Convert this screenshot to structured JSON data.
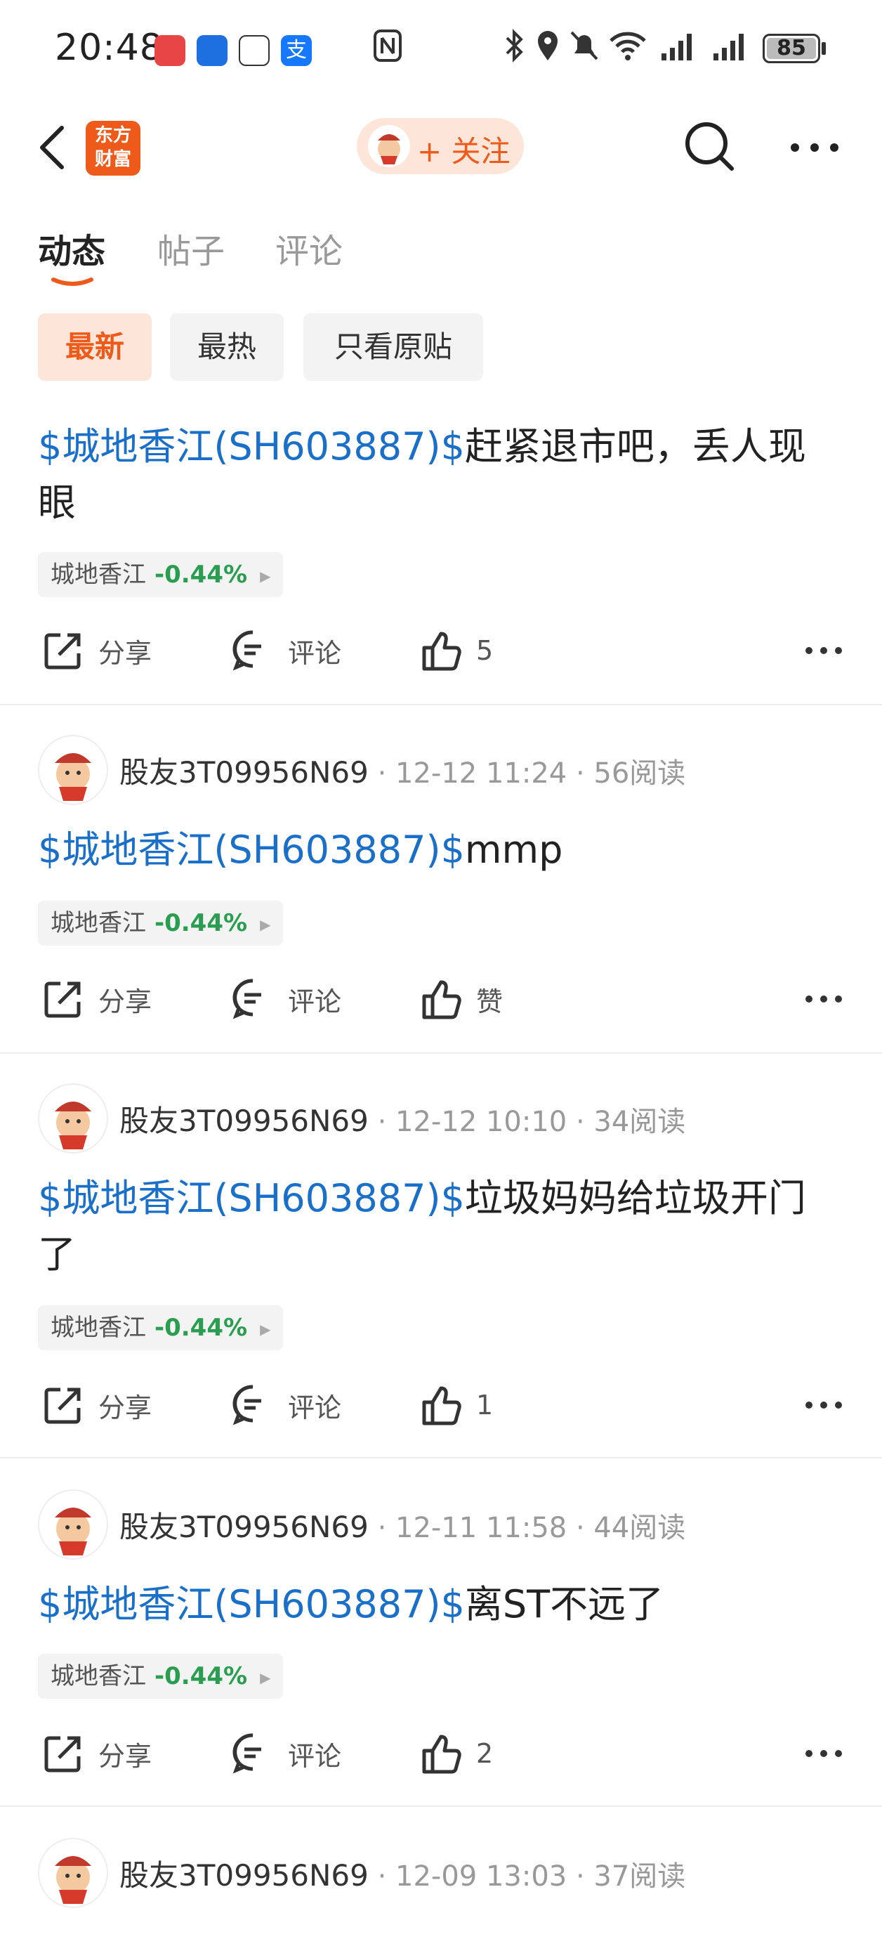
{
  "status_bar": {
    "time": "20:48",
    "battery": "85",
    "app_icons": [
      "huawei-icon",
      "browser-icon",
      "qq-icon",
      "alipay-icon"
    ],
    "icons": [
      "nfc-icon",
      "bluetooth-icon",
      "location-icon",
      "mute-icon",
      "wifi-icon",
      "signal-icon",
      "signal-icon",
      "battery-icon"
    ]
  },
  "header": {
    "logo_line1": "东方",
    "logo_line2": "财富",
    "follow_label": "+ 关注"
  },
  "tabs": [
    {
      "label": "动态",
      "active": true
    },
    {
      "label": "帖子",
      "active": false
    },
    {
      "label": "评论",
      "active": false
    }
  ],
  "filters": [
    {
      "label": "最新",
      "active": true
    },
    {
      "label": "最热",
      "active": false
    },
    {
      "label": "只看原贴",
      "active": false
    }
  ],
  "common": {
    "share": "分享",
    "comment": "评论",
    "stock_name": "城地香江",
    "stock_pct": "-0.44%",
    "colors": {
      "accent": "#ee5a1a",
      "link": "#1a6fc9",
      "up_down": "#2a9d50"
    }
  },
  "posts": [
    {
      "stock_link": "$城地香江(SH603887)$",
      "text_line1": "赶紧退市吧，丢人现",
      "text_line2": "眼",
      "likes": "5"
    },
    {
      "user": "股友3T09956N69",
      "time": "12-12 11:24",
      "reads": "56阅读",
      "stock_link": "$城地香江(SH603887)$",
      "text_line1": "mmp",
      "likes": "赞"
    },
    {
      "user": "股友3T09956N69",
      "time": "12-12 10:10",
      "reads": "34阅读",
      "stock_link": "$城地香江(SH603887)$",
      "text_line1": "垃圾妈妈给垃圾开门",
      "text_line2": "了",
      "likes": "1"
    },
    {
      "user": "股友3T09956N69",
      "time": "12-11 11:58",
      "reads": "44阅读",
      "stock_link": "$城地香江(SH603887)$",
      "text_line1": "离ST不远了",
      "likes": "2"
    },
    {
      "user": "股友3T09956N69",
      "time": "12-09 13:03",
      "reads": "37阅读"
    }
  ]
}
